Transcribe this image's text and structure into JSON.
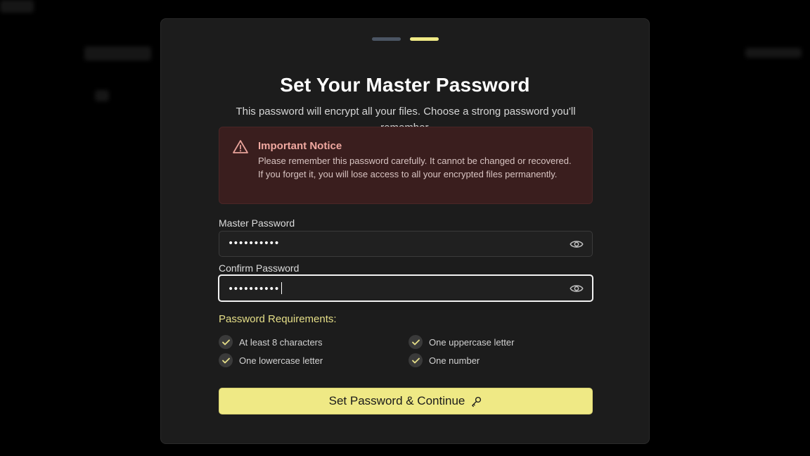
{
  "colors": {
    "step_inactive": "#4b5563",
    "step_active": "#efe985",
    "accent": "#efe985",
    "notice_bg": "#3a1e1e",
    "notice_title": "#f0a8a0",
    "check": "#e6df88"
  },
  "steps": [
    {
      "state": "complete"
    },
    {
      "state": "active"
    }
  ],
  "header": {
    "title": "Set Your Master Password",
    "subtitle": "This password will encrypt all your files. Choose a strong password you'll remember."
  },
  "notice": {
    "icon": "warning-triangle-icon",
    "title": "Important Notice",
    "body": "Please remember this password carefully. It cannot be changed or recovered. If you forget it, you will lose access to all your encrypted files permanently."
  },
  "fields": {
    "master": {
      "label": "Master Password",
      "value": "••••••••••",
      "icon": "eye-icon"
    },
    "confirm": {
      "label": "Confirm Password",
      "value": "••••••••••",
      "icon": "eye-icon"
    }
  },
  "requirements": {
    "title": "Password Requirements:",
    "items": [
      {
        "label": "At least 8 characters",
        "met": true
      },
      {
        "label": "One uppercase letter",
        "met": true
      },
      {
        "label": "One lowercase letter",
        "met": true
      },
      {
        "label": "One number",
        "met": true
      }
    ]
  },
  "cta": {
    "label": "Set Password & Continue",
    "icon": "key-icon"
  }
}
